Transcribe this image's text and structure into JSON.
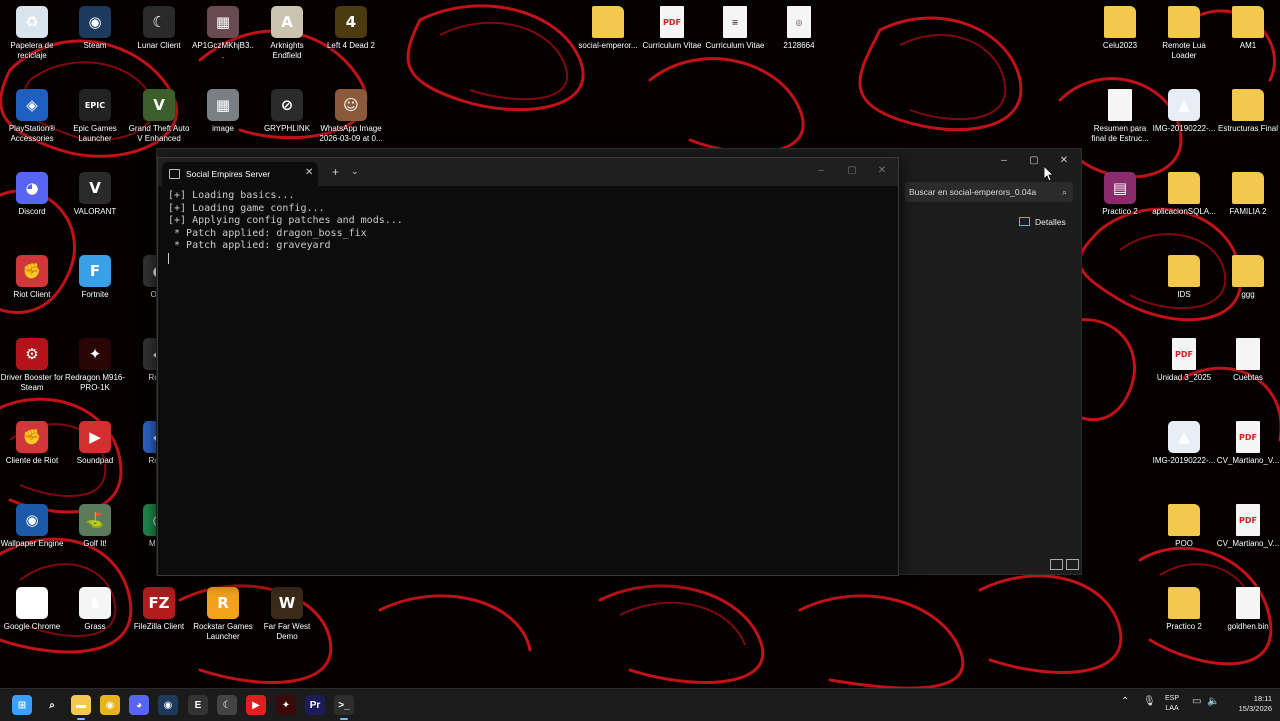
{
  "desktop": {
    "icons": [
      {
        "label": "Papelera de reciclaje",
        "icon": "recycle-bin-icon",
        "color": "#d8e4ee",
        "glyph": "♻"
      },
      {
        "label": "Steam",
        "icon": "steam-icon",
        "color": "#1b3a5c",
        "glyph": "◉"
      },
      {
        "label": "Lunar Client",
        "icon": "lunar-client-icon",
        "color": "#2a2a2a",
        "glyph": "☾"
      },
      {
        "label": "AP1GczMKhjB3...",
        "icon": "image-file-icon",
        "color": "#6a4a52",
        "glyph": "▦"
      },
      {
        "label": "Arknights Endfield",
        "icon": "arknights-icon",
        "color": "#c9c3b0",
        "glyph": "A"
      },
      {
        "label": "Left 4 Dead 2",
        "icon": "left4dead-icon",
        "color": "#4c3a10",
        "glyph": "4"
      },
      {
        "label": "social-emperor...",
        "icon": "folder-icon",
        "color": "#f2c94c",
        "glyph": ""
      },
      {
        "label": "Curriculum Vitae",
        "icon": "pdf-icon",
        "color": "#f5f5f5",
        "glyph": "PDF"
      },
      {
        "label": "Curriculum Vitae",
        "icon": "document-icon",
        "color": "#f5f5f5",
        "glyph": "≡"
      },
      {
        "label": "2128664",
        "icon": "document-icon",
        "color": "#f5f5f5",
        "glyph": "◎"
      },
      {
        "label": "Celu2023",
        "icon": "folder-icon",
        "color": "#f2c94c",
        "glyph": ""
      },
      {
        "label": "Remote Lua Loader",
        "icon": "folder-icon",
        "color": "#f2c94c",
        "glyph": ""
      },
      {
        "label": "AM1",
        "icon": "folder-icon",
        "color": "#f2c94c",
        "glyph": ""
      },
      {
        "label": "PlayStation® Accessories",
        "icon": "playstation-icon",
        "color": "#1f5fbf",
        "glyph": "◈"
      },
      {
        "label": "Epic Games Launcher",
        "icon": "epic-games-icon",
        "color": "#222222",
        "glyph": "EPIC"
      },
      {
        "label": "Grand Theft Auto V Enhanced",
        "icon": "gta-icon",
        "color": "#3b5e2b",
        "glyph": "V"
      },
      {
        "label": "image",
        "icon": "image-file-icon",
        "color": "#7a7f86",
        "glyph": "▦"
      },
      {
        "label": "GRYPHLINK",
        "icon": "gryphlink-icon",
        "color": "#2b2b2b",
        "glyph": "⊘"
      },
      {
        "label": "WhatsApp Image 2026-03-09 at 0...",
        "icon": "image-file-icon",
        "color": "#8a5a3a",
        "glyph": "☺"
      },
      {
        "label": "Resumen para final de Estruc...",
        "icon": "document-icon",
        "color": "#f5f5f5",
        "glyph": ""
      },
      {
        "label": "IMG-20190222-...",
        "icon": "image-file-icon",
        "color": "#e8eef6",
        "glyph": "▲"
      },
      {
        "label": "Estructuras Final",
        "icon": "folder-icon",
        "color": "#f2c94c",
        "glyph": ""
      },
      {
        "label": "Discord",
        "icon": "discord-icon",
        "color": "#5865f2",
        "glyph": "◕"
      },
      {
        "label": "VALORANT",
        "icon": "valorant-icon",
        "color": "#2a2a2a",
        "glyph": "V"
      },
      {
        "label": "Practico 2",
        "icon": "winrar-icon",
        "color": "#8a2b6b",
        "glyph": "▤"
      },
      {
        "label": "aplicacionSQLA...",
        "icon": "folder-icon",
        "color": "#f2c94c",
        "glyph": ""
      },
      {
        "label": "FAMILIA 2",
        "icon": "folder-icon",
        "color": "#f2c94c",
        "glyph": ""
      },
      {
        "label": "Riot Client",
        "icon": "riot-client-icon",
        "color": "#d13639",
        "glyph": "✊"
      },
      {
        "label": "Fortnite",
        "icon": "fortnite-icon",
        "color": "#3aa0e6",
        "glyph": "F"
      },
      {
        "label": "OBS",
        "icon": "obs-icon",
        "color": "#333333",
        "glyph": "◐"
      },
      {
        "label": "IDS",
        "icon": "folder-icon",
        "color": "#f2c94c",
        "glyph": ""
      },
      {
        "label": "ggg",
        "icon": "folder-icon",
        "color": "#f2c94c",
        "glyph": ""
      },
      {
        "label": "Driver Booster for Steam",
        "icon": "driver-booster-icon",
        "color": "#b3141b",
        "glyph": "⚙"
      },
      {
        "label": "Redragon M916-PRO-1K",
        "icon": "redragon-icon",
        "color": "#2a0505",
        "glyph": "✦"
      },
      {
        "label": "Roblo",
        "icon": "roblox-icon",
        "color": "#333333",
        "glyph": "◆"
      },
      {
        "label": "Unidad 3_2025",
        "icon": "pdf-icon",
        "color": "#f5f5f5",
        "glyph": "PDF"
      },
      {
        "label": "Cuebtas",
        "icon": "document-icon",
        "color": "#f5f5f5",
        "glyph": ""
      },
      {
        "label": "Cliente de Riot",
        "icon": "riot-client-icon",
        "color": "#d13639",
        "glyph": "✊"
      },
      {
        "label": "Soundpad",
        "icon": "soundpad-icon",
        "color": "#d32f2f",
        "glyph": "▶"
      },
      {
        "label": "Roblo",
        "icon": "roblox-icon",
        "color": "#2b63c9",
        "glyph": "◆"
      },
      {
        "label": "IMG-20190222-...",
        "icon": "image-file-icon",
        "color": "#e8eef6",
        "glyph": "▲"
      },
      {
        "label": "CV_Martiano_V...",
        "icon": "pdf-icon",
        "color": "#f5f5f5",
        "glyph": "PDF"
      },
      {
        "label": "Wallpaper Engine",
        "icon": "wallpaper-engine-icon",
        "color": "#1a5aa8",
        "glyph": "◉"
      },
      {
        "label": "Golf It!",
        "icon": "golf-it-icon",
        "color": "#5b7b5b",
        "glyph": "⛳"
      },
      {
        "label": "Modri",
        "icon": "modrinth-icon",
        "color": "#1e8a4a",
        "glyph": "◎"
      },
      {
        "label": "POO",
        "icon": "folder-icon",
        "color": "#f2c94c",
        "glyph": ""
      },
      {
        "label": "CV_Martiano_V...",
        "icon": "pdf-icon",
        "color": "#f5f5f5",
        "glyph": "PDF"
      },
      {
        "label": "Google Chrome",
        "icon": "chrome-icon",
        "color": "#ffffff",
        "glyph": "◉"
      },
      {
        "label": "Grass",
        "icon": "grass-icon",
        "color": "#f5f5f5",
        "glyph": "♞"
      },
      {
        "label": "FileZilla Client",
        "icon": "filezilla-icon",
        "color": "#b11c1c",
        "glyph": "FZ"
      },
      {
        "label": "Rockstar Games Launcher",
        "icon": "rockstar-icon",
        "color": "#f4a21b",
        "glyph": "R"
      },
      {
        "label": "Far Far West Demo",
        "icon": "far-far-west-icon",
        "color": "#3a2a1a",
        "glyph": "W"
      },
      {
        "label": "Practico 2",
        "icon": "folder-icon",
        "color": "#f2c94c",
        "glyph": ""
      },
      {
        "label": "goldhen.bin",
        "icon": "document-icon",
        "color": "#f5f5f5",
        "glyph": ""
      }
    ]
  },
  "explorer": {
    "search_placeholder": "Buscar en social-emperors_0.04a",
    "details_label": "Detalles"
  },
  "terminal": {
    "tab_title": "Social Empires Server",
    "new_tab_symbol": "+",
    "lines": [
      "[+] Loading basics...",
      "[+] Loading game config...",
      "[+] Applying config patches and mods...",
      " * Patch applied: dragon_boss_fix",
      " * Patch applied: graveyard"
    ]
  },
  "taskbar": {
    "apps": [
      {
        "icon": "windows-start-icon",
        "color": "#3aa0ff",
        "glyph": "⊞",
        "active": false
      },
      {
        "icon": "search-icon",
        "color": "transparent",
        "glyph": "⌕",
        "active": false
      },
      {
        "icon": "file-explorer-icon",
        "color": "#f2c94c",
        "glyph": "▬",
        "active": true
      },
      {
        "icon": "chrome-icon",
        "color": "#e8b21e",
        "glyph": "◉",
        "active": false
      },
      {
        "icon": "discord-icon",
        "color": "#5865f2",
        "glyph": "◕",
        "active": false
      },
      {
        "icon": "steam-icon",
        "color": "#1b3a5c",
        "glyph": "◉",
        "active": false
      },
      {
        "icon": "epic-games-icon",
        "color": "#333333",
        "glyph": "E",
        "active": false
      },
      {
        "icon": "lunar-client-icon",
        "color": "#444444",
        "glyph": "☾",
        "active": false
      },
      {
        "icon": "youtube-icon",
        "color": "#e02020",
        "glyph": "▶",
        "active": false
      },
      {
        "icon": "redragon-icon",
        "color": "#3a0a0a",
        "glyph": "✦",
        "active": false
      },
      {
        "icon": "premiere-pro-icon",
        "color": "#1c1c5a",
        "glyph": "Pr",
        "active": false
      },
      {
        "icon": "terminal-icon",
        "color": "#2e2e2e",
        "glyph": ">_",
        "active": true
      }
    ],
    "lang_line1": "ESP",
    "lang_line2": "LAA",
    "time": "18:11",
    "date": "15/3/2026"
  }
}
